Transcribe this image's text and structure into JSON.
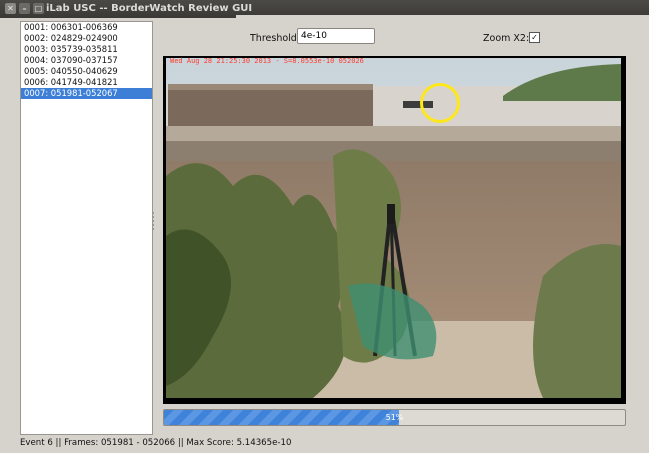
{
  "window": {
    "title": "iLab USC -- BorderWatch Review GUI"
  },
  "events": [
    "0001: 006301-006369",
    "0002: 024829-024900",
    "0003: 035739-035811",
    "0004: 037090-037157",
    "0005: 040550-040629",
    "0006: 041749-041821",
    "0007: 051981-052067"
  ],
  "selected_event_index": 6,
  "controls": {
    "threshold_label": "Threshold:",
    "threshold_value": "4e-10",
    "zoom_label": "Zoom X2:",
    "zoom_checked": true,
    "zoom_check_glyph": "✓"
  },
  "video": {
    "overlay_text": "Wed Aug 28 21:25:30 2013 - S=8.0553e-10 052026",
    "overlay_color": "#ff3d2e",
    "marker_color": "#ffe81a"
  },
  "progress": {
    "value": 0.51,
    "label": "51%"
  },
  "status": {
    "text": "Event 6 || Frames: 051981 - 052066 || Max Score: 5.14365e-10"
  }
}
